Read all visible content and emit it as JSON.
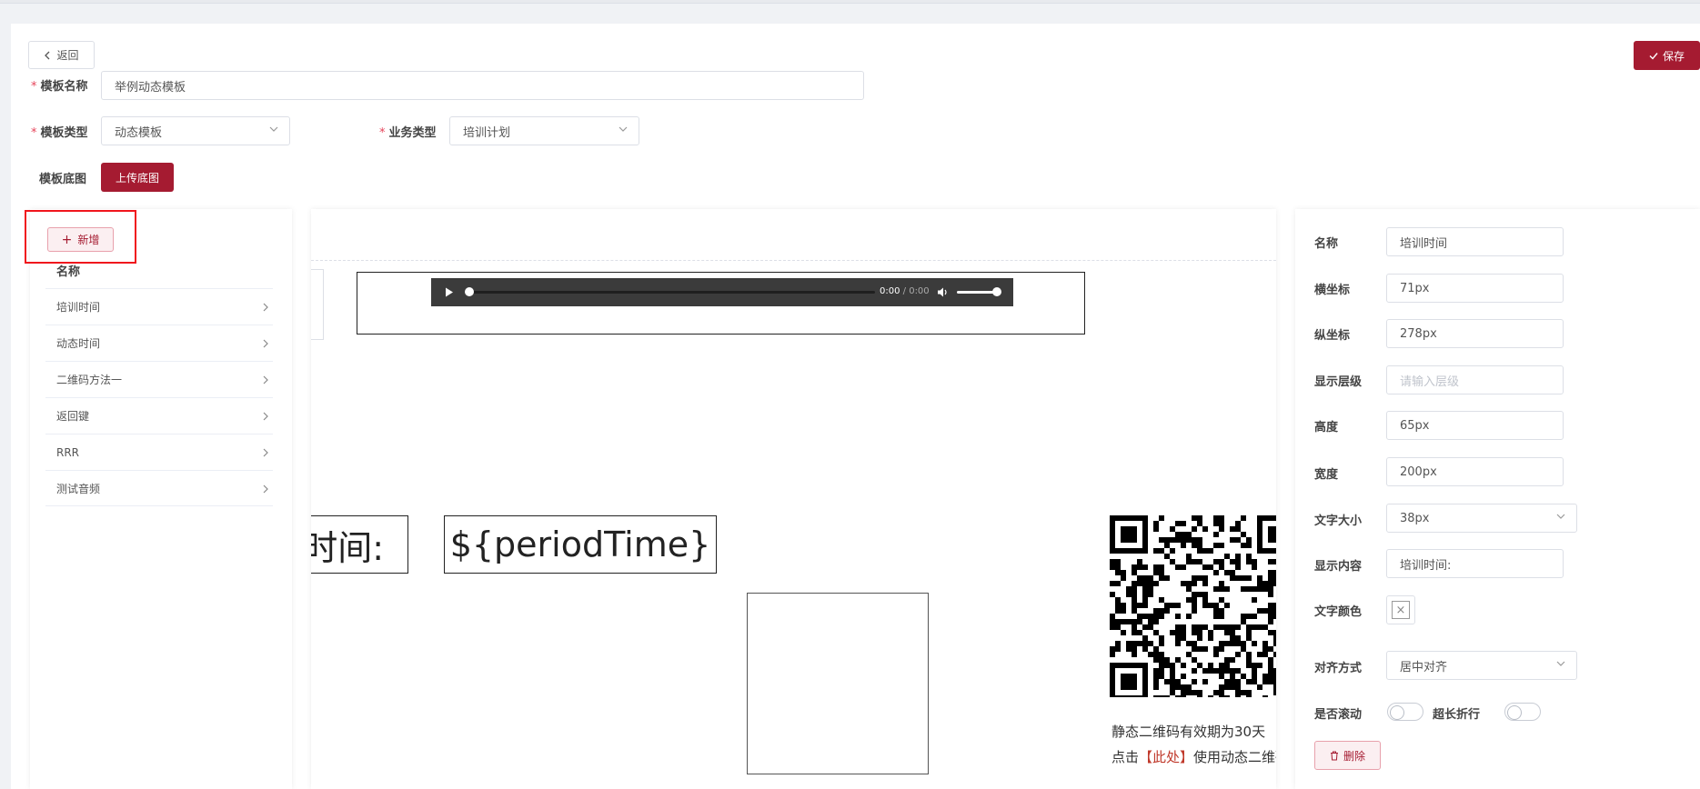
{
  "header": {
    "back_label": "返回",
    "save_label": "保存"
  },
  "form": {
    "template_name_label": "模板名称",
    "template_name_value": "举例动态模板",
    "template_type_label": "模板类型",
    "template_type_value": "动态模板",
    "business_type_label": "业务类型",
    "business_type_value": "培训计划",
    "background_label": "模板底图",
    "upload_label": "上传底图"
  },
  "layer_list": {
    "add_label": "新增",
    "column_header": "名称",
    "items": [
      {
        "label": "培训时间"
      },
      {
        "label": "动态时间"
      },
      {
        "label": "二维码方法一"
      },
      {
        "label": "返回键"
      },
      {
        "label": "RRR"
      },
      {
        "label": "测试音频"
      }
    ]
  },
  "canvas": {
    "audio_time": "0:00",
    "audio_duration": "/ 0:00",
    "audio_volume": 0.95,
    "label_text": "时间:",
    "variable_text": "${periodTime}",
    "qr_note_line1": "静态二维码有效期为30天",
    "qr_note_line2_prefix": "点击",
    "qr_note_line2_link": "【此处】",
    "qr_note_line2_suffix": "使用动态二维码"
  },
  "properties": {
    "name_label": "名称",
    "name_value": "培训时间",
    "x_label": "横坐标",
    "x_value": "71px",
    "y_label": "纵坐标",
    "y_value": "278px",
    "zindex_label": "显示层级",
    "zindex_placeholder": "请输入层级",
    "height_label": "高度",
    "height_value": "65px",
    "width_label": "宽度",
    "width_value": "200px",
    "fontsize_label": "文字大小",
    "fontsize_value": "38px",
    "content_label": "显示内容",
    "content_value": "培训时间:",
    "color_label": "文字颜色",
    "align_label": "对齐方式",
    "align_value": "居中对齐",
    "scroll_label": "是否滚动",
    "scroll_on": false,
    "wrap_label": "超长折行",
    "wrap_on": false,
    "delete_label": "删除"
  },
  "colors": {
    "primary": "#a51b31",
    "highlight_outline": "#f0161d"
  }
}
